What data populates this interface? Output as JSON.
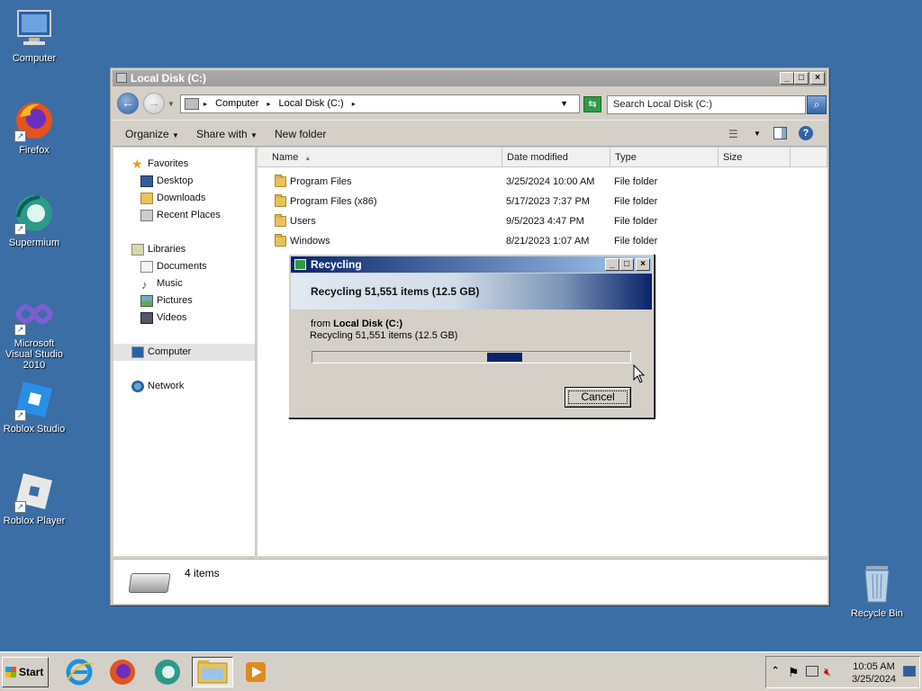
{
  "desktop": {
    "icons": [
      {
        "label": "Computer"
      },
      {
        "label": "Firefox"
      },
      {
        "label": "Supermium"
      },
      {
        "label": "Microsoft Visual Studio 2010"
      },
      {
        "label": "Roblox Studio"
      },
      {
        "label": "Roblox Player"
      },
      {
        "label": "Recycle Bin"
      }
    ]
  },
  "explorer": {
    "title": "Local Disk (C:)",
    "breadcrumb": [
      "Computer",
      "Local Disk (C:)"
    ],
    "search_placeholder": "Search Local Disk (C:)",
    "toolbar": {
      "organize": "Organize",
      "share_with": "Share with",
      "new_folder": "New folder"
    },
    "nav": {
      "favorites": "Favorites",
      "desktop": "Desktop",
      "downloads": "Downloads",
      "recent": "Recent Places",
      "libraries": "Libraries",
      "documents": "Documents",
      "music": "Music",
      "pictures": "Pictures",
      "videos": "Videos",
      "computer": "Computer",
      "network": "Network"
    },
    "columns": {
      "name": "Name",
      "date": "Date modified",
      "type": "Type",
      "size": "Size"
    },
    "rows": [
      {
        "name": "Program Files",
        "date": "3/25/2024 10:00 AM",
        "type": "File folder"
      },
      {
        "name": "Program Files (x86)",
        "date": "5/17/2023 7:37 PM",
        "type": "File folder"
      },
      {
        "name": "Users",
        "date": "9/5/2023 4:47 PM",
        "type": "File folder"
      },
      {
        "name": "Windows",
        "date": "8/21/2023 1:07 AM",
        "type": "File folder"
      }
    ],
    "details": {
      "count": "4 items"
    }
  },
  "dialog": {
    "title": "Recycling",
    "banner": "Recycling 51,551 items (12.5 GB)",
    "from_prefix": "from",
    "from_source": "Local Disk (C:)",
    "status": "Recycling 51,551 items (12.5 GB)",
    "cancel": "Cancel",
    "progress_fill_start_pct": 55,
    "progress_fill_width_pct": 11
  },
  "taskbar": {
    "start": "Start",
    "time": "10:05 AM",
    "date": "3/25/2024"
  },
  "colors": {
    "desktop": "#3a6ea5",
    "titlebar_active": "#0a246a",
    "title_inactive": "#9d9d9d"
  }
}
